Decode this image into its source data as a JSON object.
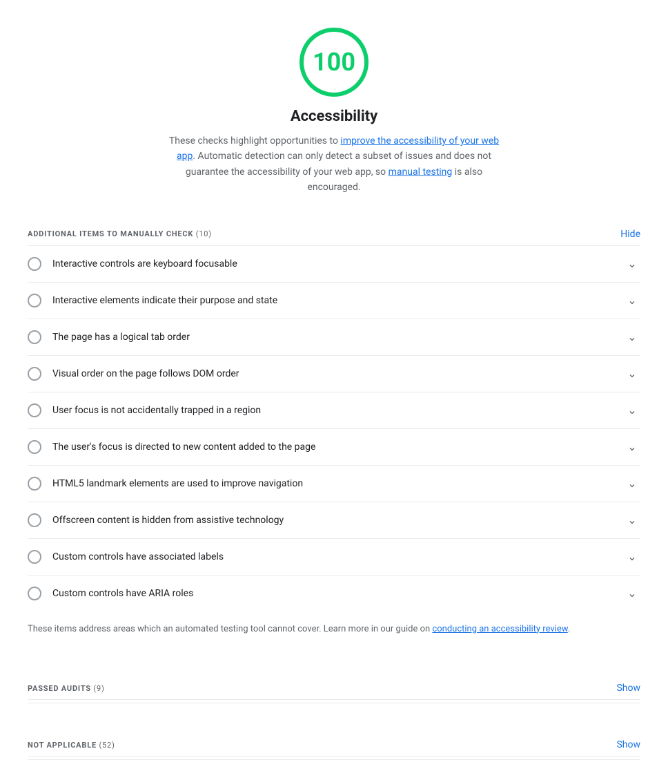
{
  "score": {
    "value": "100",
    "label": "Accessibility",
    "description_part1": "These checks highlight opportunities to ",
    "link1_text": "improve the accessibility of your web app",
    "description_part2": ". Automatic detection can only detect a subset of issues and does not guarantee the accessibility of your web app, so ",
    "link2_text": "manual testing",
    "description_part3": " is also encouraged."
  },
  "manual_section": {
    "title": "ADDITIONAL ITEMS TO MANUALLY CHECK",
    "count": "(10)",
    "action": "Hide"
  },
  "audit_items": [
    {
      "label": "Interactive controls are keyboard focusable"
    },
    {
      "label": "Interactive elements indicate their purpose and state"
    },
    {
      "label": "The page has a logical tab order"
    },
    {
      "label": "Visual order on the page follows DOM order"
    },
    {
      "label": "User focus is not accidentally trapped in a region"
    },
    {
      "label": "The user's focus is directed to new content added to the page"
    },
    {
      "label": "HTML5 landmark elements are used to improve navigation"
    },
    {
      "label": "Offscreen content is hidden from assistive technology"
    },
    {
      "label": "Custom controls have associated labels"
    },
    {
      "label": "Custom controls have ARIA roles"
    }
  ],
  "manual_check_note": {
    "text_before": "These items address areas which an automated testing tool cannot cover. Learn more in our guide on ",
    "link_text": "conducting an accessibility review",
    "text_after": "."
  },
  "passed_section": {
    "title": "PASSED AUDITS",
    "count": "(9)",
    "action": "Show"
  },
  "not_applicable_section": {
    "title": "NOT APPLICABLE",
    "count": "(52)",
    "action": "Show"
  }
}
